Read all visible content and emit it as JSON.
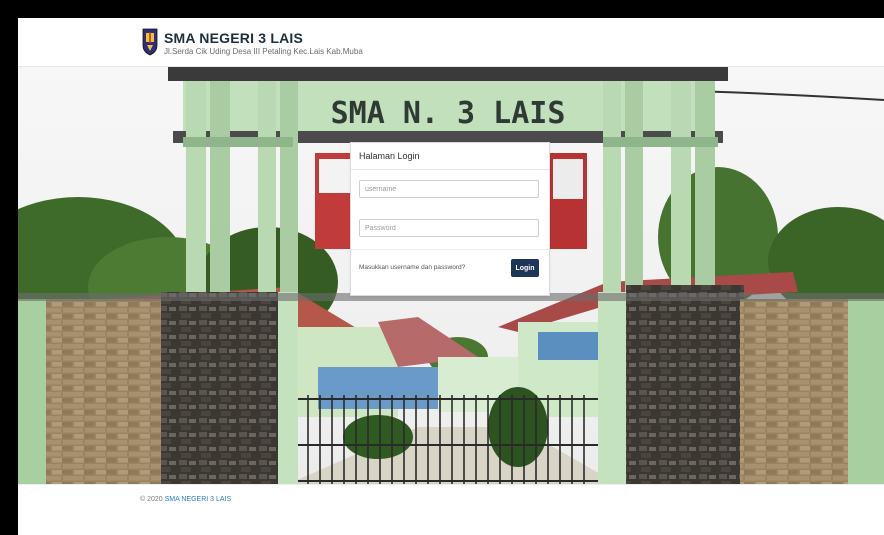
{
  "header": {
    "title": "SMA NEGERI 3 LAIS",
    "subtitle": "Jl.Serda Cik Uding Desa III Petaling Kec.Lais Kab.Muba"
  },
  "photo": {
    "gate_sign": "SMA N. 3 LAIS"
  },
  "login": {
    "title": "Halaman Login",
    "username_placeholder": "username",
    "password_placeholder": "Password",
    "hint": "Masukkan username dan password?",
    "button_label": "Login"
  },
  "footer": {
    "copyright": "© 2020",
    "link_text": "SMA NEGERI 3 LAIS"
  },
  "colors": {
    "primary": "#1d3557",
    "link": "#2b7bbf",
    "gate_green": "#bde0ba"
  },
  "icons": {
    "logo": "school-crest-icon"
  }
}
